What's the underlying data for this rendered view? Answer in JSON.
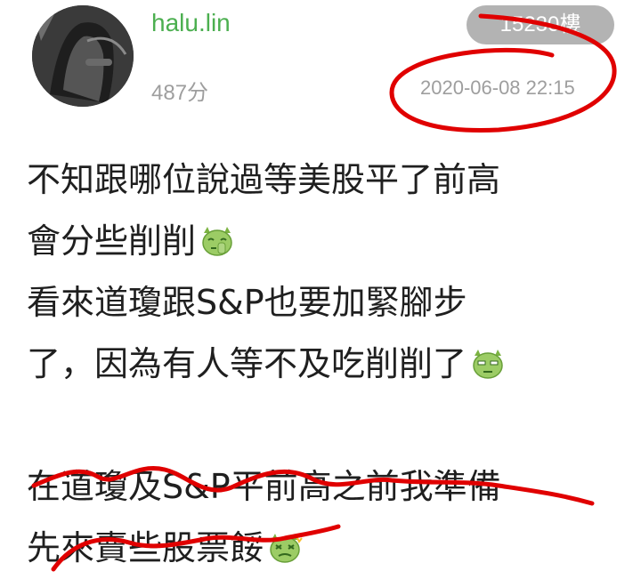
{
  "post": {
    "username": "halu.lin",
    "score": "487分",
    "floor": "15230樓",
    "timestamp": "2020-06-08 22:15"
  },
  "content": {
    "line1": "不知跟哪位說過等美股平了前高",
    "line2": "會分些削削",
    "line3": "看來道瓊跟S&P也要加緊腳步",
    "line4": "了，因為有人等不及吃削削了",
    "line5": "在道瓊及S&P平前高之前我準備",
    "line6": "先來賣些股票餒"
  },
  "icons": {
    "avatar": "car-seat-avatar",
    "emoji1": "green-devil-shush-emoji",
    "emoji2": "green-devil-annoyed-emoji",
    "emoji3": "green-devil-sick-emoji"
  },
  "colors": {
    "username": "#4caf50",
    "badge_bg": "#b3b3b3",
    "meta_text": "#9e9e9e",
    "annotation": "#e00000",
    "emoji_green": "#9ccc65"
  }
}
